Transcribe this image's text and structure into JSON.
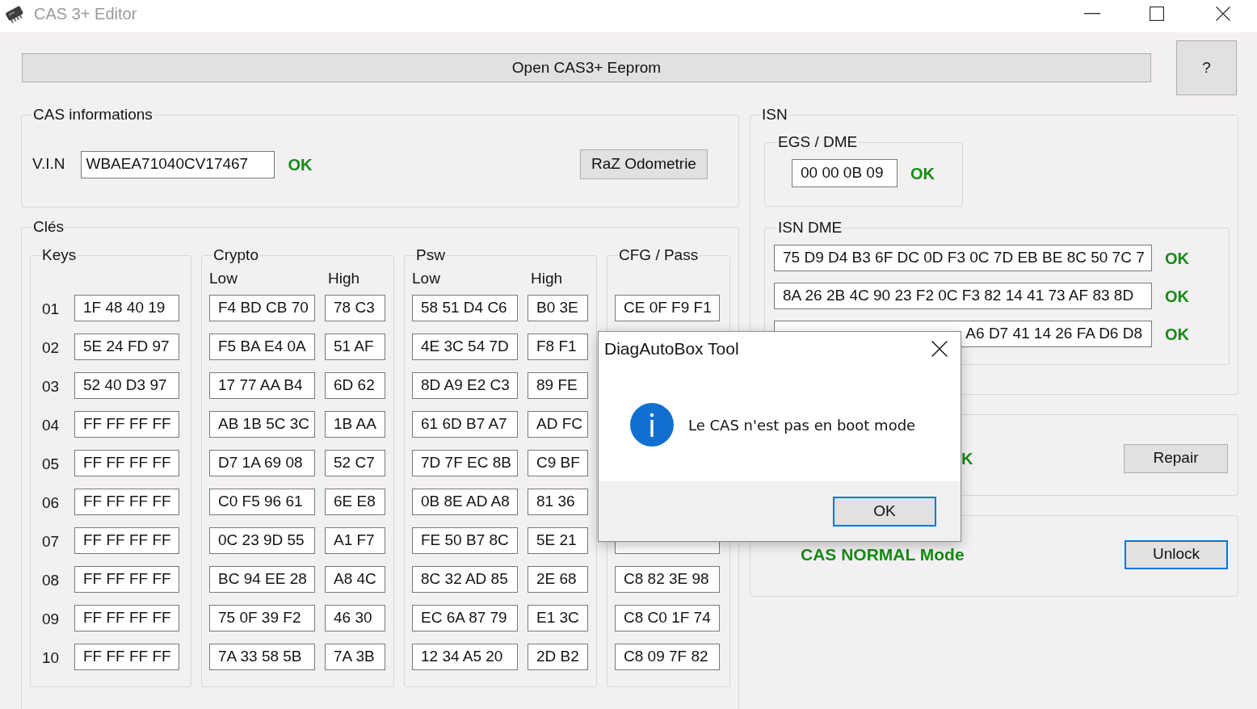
{
  "window": {
    "title": "CAS 3+ Editor"
  },
  "toolbar": {
    "open_button": {
      "label": "Open CAS3+ Eeprom",
      "focused": false
    },
    "help_button": {
      "label": "?",
      "focused": false
    }
  },
  "cas_informations": {
    "title": "CAS informations",
    "vin_label": "V.I.N",
    "vin_value": "WBAEA71040CV17467",
    "vin_status": "OK",
    "reset_button": {
      "label": "RaZ Odometrie",
      "focused": false
    }
  },
  "cles": {
    "title": "Clés",
    "keys": {
      "title": "Keys",
      "rows": [
        {
          "number": "01",
          "value": "1F 48 40 19"
        },
        {
          "number": "02",
          "value": "5E 24 FD 97"
        },
        {
          "number": "03",
          "value": "52 40 D3 97"
        },
        {
          "number": "04",
          "value": "FF FF FF FF"
        },
        {
          "number": "05",
          "value": "FF FF FF FF"
        },
        {
          "number": "06",
          "value": "FF FF FF FF"
        },
        {
          "number": "07",
          "value": "FF FF FF FF"
        },
        {
          "number": "08",
          "value": "FF FF FF FF"
        },
        {
          "number": "09",
          "value": "FF FF FF FF"
        },
        {
          "number": "10",
          "value": "FF FF FF FF"
        }
      ]
    },
    "crypto": {
      "title": "Crypto",
      "low_label": "Low",
      "high_label": "High",
      "rows": [
        {
          "low": "F4 BD CB 70",
          "high": "78 C3"
        },
        {
          "low": "F5 BA E4 0A",
          "high": "51 AF"
        },
        {
          "low": "17 77 AA B4",
          "high": "6D 62"
        },
        {
          "low": "AB 1B 5C 3C",
          "high": "1B AA"
        },
        {
          "low": "D7 1A 69 08",
          "high": "52 C7"
        },
        {
          "low": "C0 F5 96 61",
          "high": "6E E8"
        },
        {
          "low": "0C 23 9D 55",
          "high": "A1 F7"
        },
        {
          "low": "BC 94 EE 28",
          "high": "A8 4C"
        },
        {
          "low": "75 0F 39 F2",
          "high": "46 30"
        },
        {
          "low": "7A 33 58 5B",
          "high": "7A 3B"
        }
      ]
    },
    "psw": {
      "title": "Psw",
      "low_label": "Low",
      "high_label": "High",
      "rows": [
        {
          "low": "58 51 D4 C6",
          "high": "B0 3E"
        },
        {
          "low": "4E 3C 54 7D",
          "high": "F8 F1"
        },
        {
          "low": "8D A9 E2 C3",
          "high": "89 FE"
        },
        {
          "low": "61 6D B7 A7",
          "high": "AD FC"
        },
        {
          "low": "7D 7F EC 8B",
          "high": "C9 BF"
        },
        {
          "low": "0B 8E AD A8",
          "high": "81 36"
        },
        {
          "low": "FE 50 B7 8C",
          "high": "5E 21"
        },
        {
          "low": "8C 32 AD 85",
          "high": "2E 68"
        },
        {
          "low": "EC 6A 87 79",
          "high": "E1 3C"
        },
        {
          "low": "12 34 A5 20",
          "high": "2D B2"
        }
      ]
    },
    "cfg_pass": {
      "title": "CFG / Pass",
      "rows_top": [
        {
          "value": "CE 0F F9 F1"
        }
      ],
      "partly_hidden_field": true,
      "rows_bottom": [
        {
          "value": "C8 82 3E 98"
        },
        {
          "value": "C8 C0 1F 74"
        },
        {
          "value": "C8 09 7F 82"
        }
      ]
    }
  },
  "isn": {
    "title": "ISN",
    "egs_dme": {
      "title": "EGS / DME",
      "value": "00 00 0B 09",
      "status": "OK"
    },
    "isn_dme": {
      "title": "ISN DME",
      "rows": [
        {
          "value": "75 D9 D4 B3 6F DC 0D F3 0C 7D EB BE 8C 50 7C 7",
          "status": "OK",
          "covered": false
        },
        {
          "value": "8A 26 2B 4C 90 23 F2 0C F3 82 14 41 73 AF 83 8D",
          "status": "OK",
          "covered": false
        },
        {
          "value": "A6 D7 41 14 26 FA D6 D8",
          "status": "OK",
          "covered": true
        }
      ]
    }
  },
  "repair_panel": {
    "status": "K",
    "button": {
      "label": "Repair",
      "focused": false
    }
  },
  "mode_panel": {
    "status": "CAS NORMAL Mode",
    "button": {
      "label": "Unlock",
      "focused": true
    }
  },
  "dialog": {
    "title": "DiagAutoBox Tool",
    "message": "Le CAS n'est pas en boot mode",
    "ok_button": {
      "label": "OK",
      "focused": true
    }
  }
}
